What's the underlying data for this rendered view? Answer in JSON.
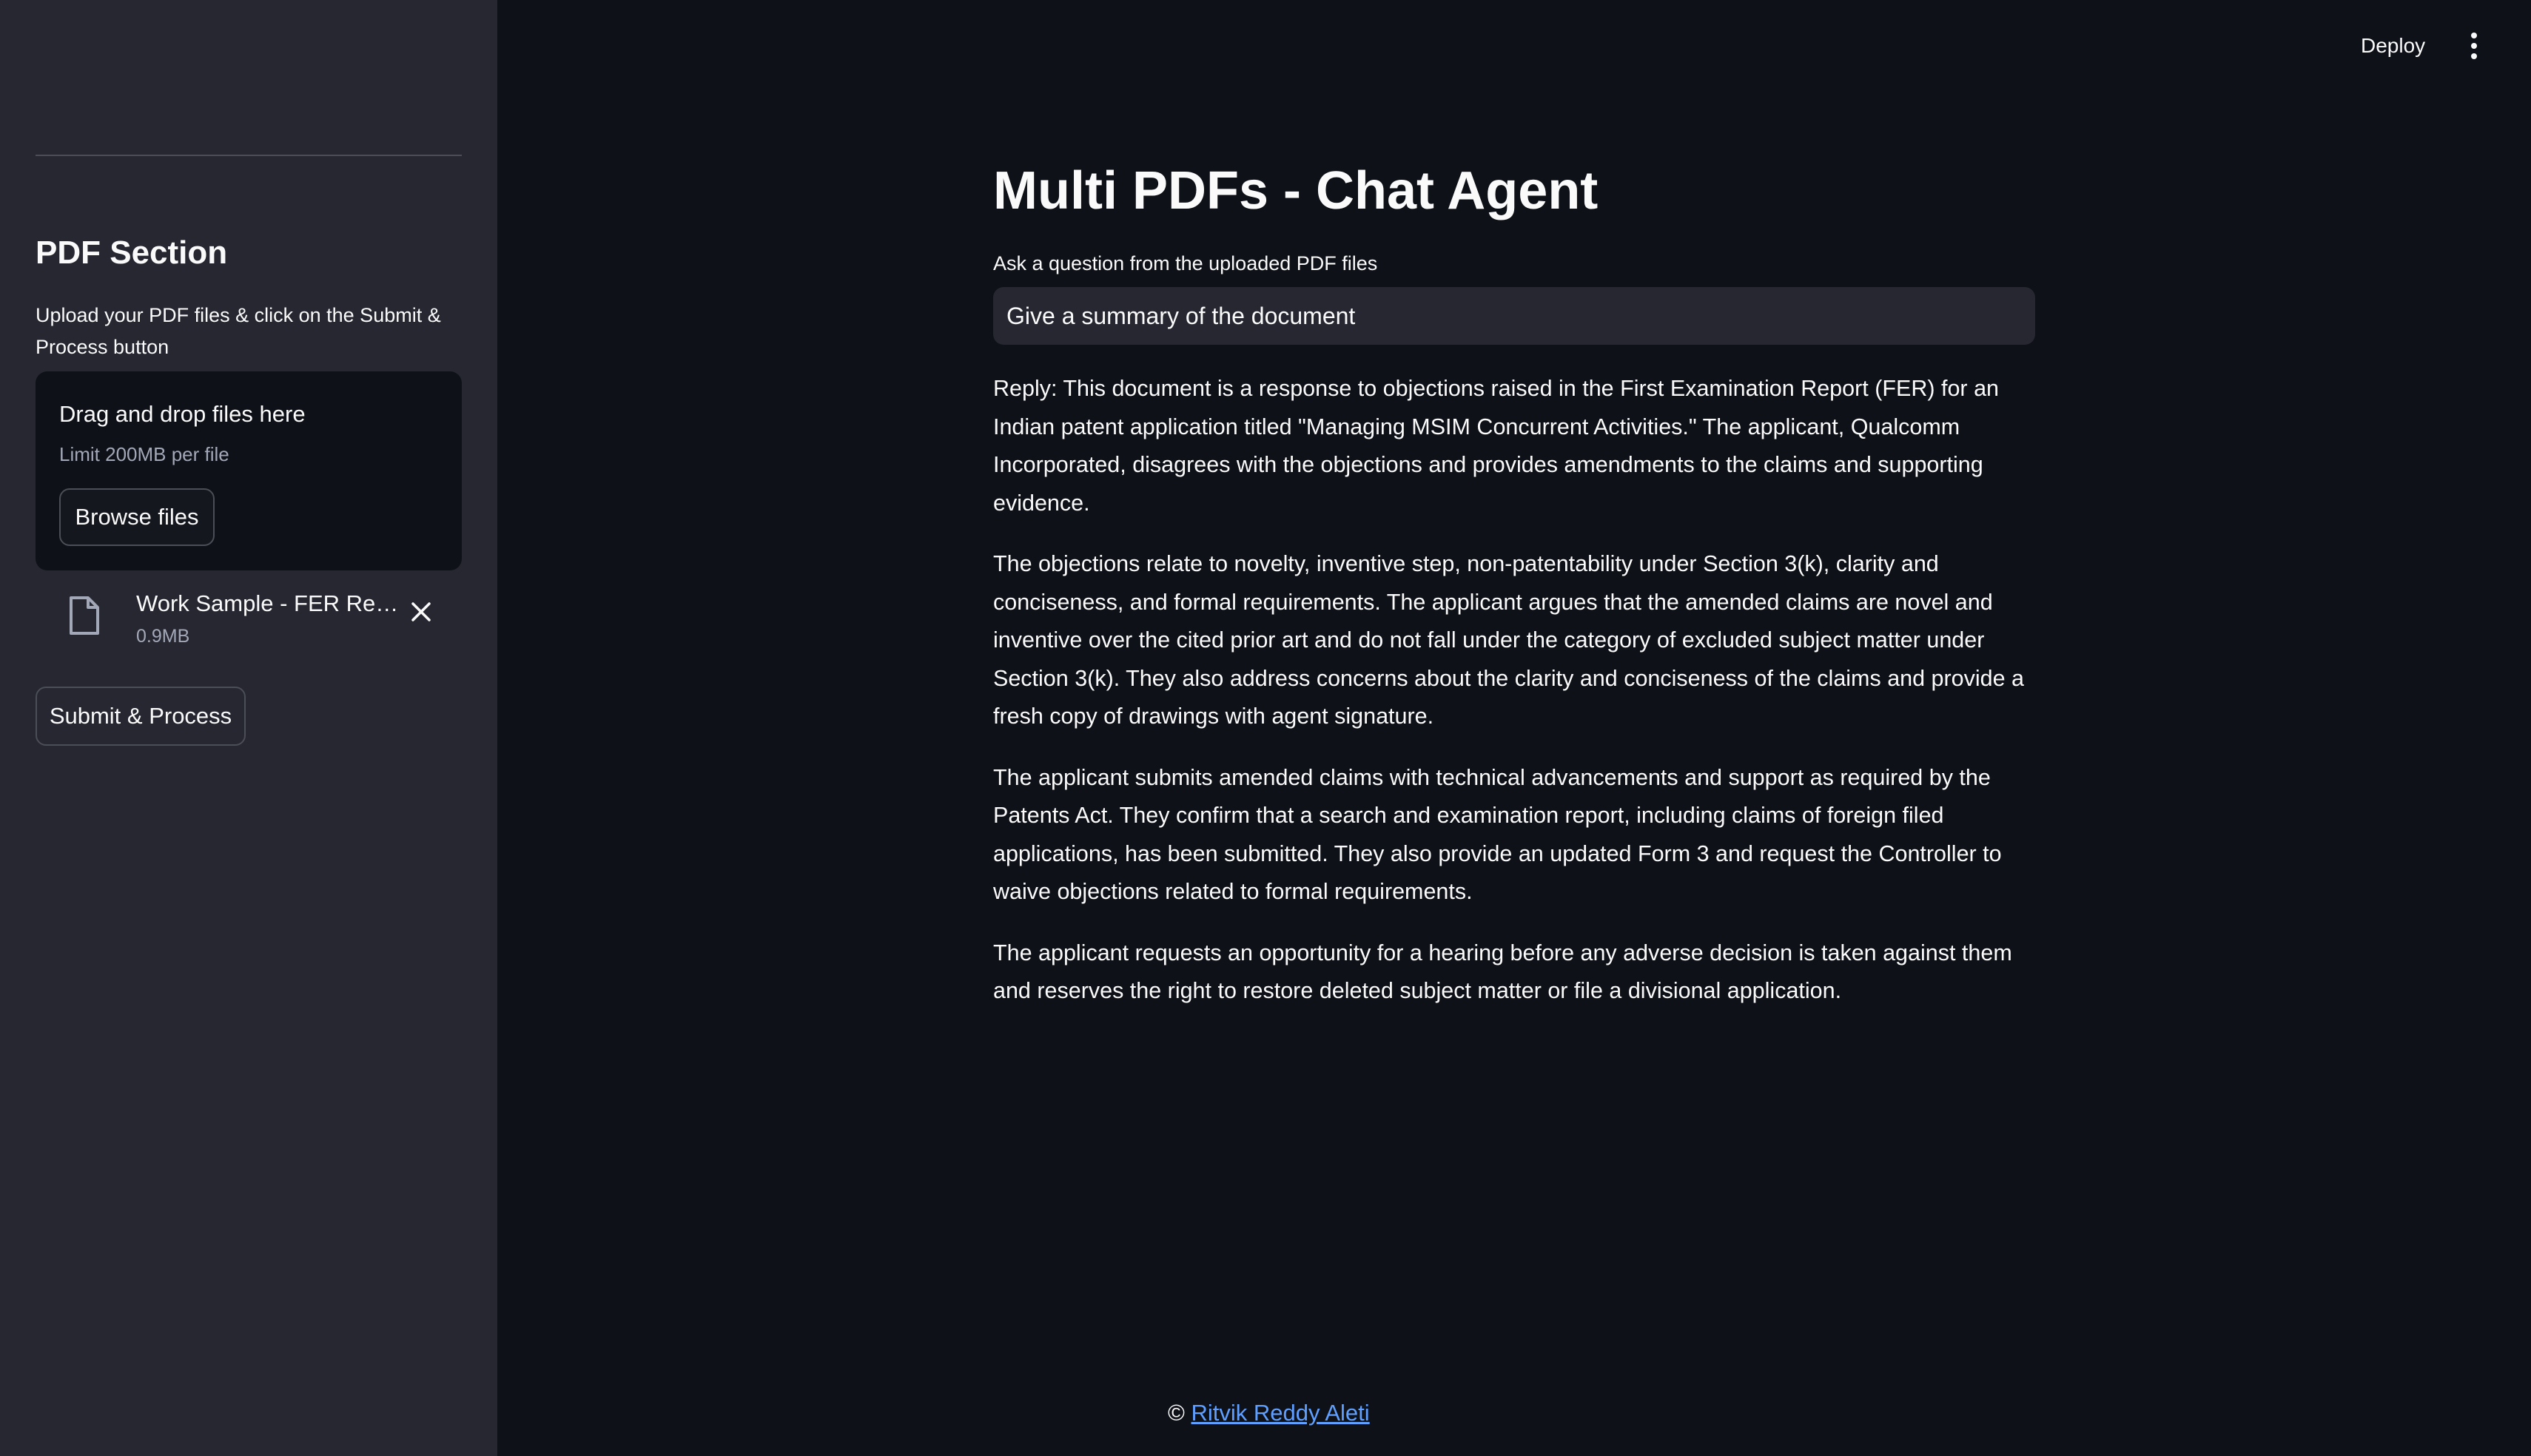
{
  "header": {
    "deploy_label": "Deploy",
    "menu_icon": "vertical-ellipsis-icon"
  },
  "sidebar": {
    "title": "PDF Section",
    "description": "Upload your PDF files & click on the Submit & Process button",
    "uploader": {
      "drag_text": "Drag and drop files here",
      "limit_text": "Limit 200MB per file",
      "browse_label": "Browse files"
    },
    "file": {
      "name": "Work Sample - FER Response.pdf",
      "size": "0.9MB",
      "icon": "file-icon",
      "remove_icon": "close-icon"
    },
    "submit_label": "Submit & Process"
  },
  "main": {
    "title": "Multi PDFs - Chat Agent",
    "question_label": "Ask a question from the uploaded PDF files",
    "question_value": "Give a summary of the document",
    "reply_paragraphs": [
      "Reply: This document is a response to objections raised in the First Examination Report (FER) for an Indian patent application titled \"Managing MSIM Concurrent Activities.\" The applicant, Qualcomm Incorporated, disagrees with the objections and provides amendments to the claims and supporting evidence.",
      "The objections relate to novelty, inventive step, non-patentability under Section 3(k), clarity and conciseness, and formal requirements. The applicant argues that the amended claims are novel and inventive over the cited prior art and do not fall under the category of excluded subject matter under Section 3(k). They also address concerns about the clarity and conciseness of the claims and provide a fresh copy of drawings with agent signature.",
      "The applicant submits amended claims with technical advancements and support as required by the Patents Act. They confirm that a search and examination report, including claims of foreign filed applications, has been submitted. They also provide an updated Form 3 and request the Controller to waive objections related to formal requirements.",
      "The applicant requests an opportunity for a hearing before any adverse decision is taken against them and reserves the right to restore deleted subject matter or file a divisional application."
    ]
  },
  "footer": {
    "copyright_symbol": "©",
    "author_link": "Ritvik Reddy Aleti"
  },
  "colors": {
    "background": "#0e1117",
    "sidebar": "#262730",
    "link": "#5f9fff"
  }
}
